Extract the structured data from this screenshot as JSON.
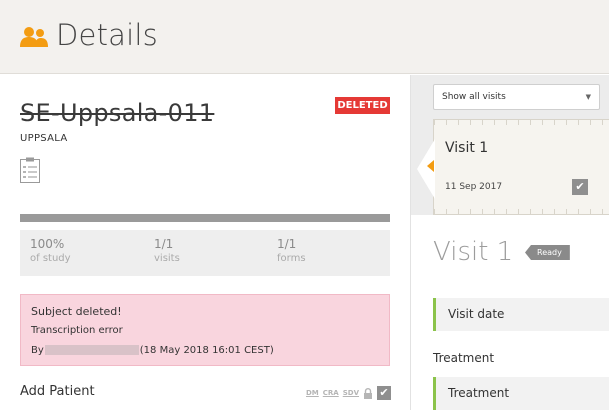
{
  "header": {
    "title": "Details",
    "icon": "users-icon",
    "accent_color": "#f39c12"
  },
  "subject": {
    "id": "SE-Uppsala-011",
    "site": "UPPSALA",
    "status_badge": "DELETED",
    "status_color": "#e53935",
    "progress_percent": 100,
    "stats": [
      {
        "value": "100%",
        "label": "of study"
      },
      {
        "value": "1/1",
        "label": "visits"
      },
      {
        "value": "1/1",
        "label": "forms"
      }
    ],
    "alert": {
      "title": "Subject deleted!",
      "reason": "Transcription error",
      "by_prefix": "By",
      "by_suffix": "(18 May 2018 16:01 CEST)"
    },
    "form_label": "Add Patient",
    "form_flags": [
      "DM",
      "CRA",
      "SDV"
    ]
  },
  "visits_panel": {
    "filter_value": "Show all visits",
    "visit_card": {
      "title": "Visit 1",
      "date": "11 Sep 2017"
    },
    "selected_visit": {
      "title": "Visit 1",
      "status": "Ready"
    },
    "form_rows": [
      {
        "label": "Visit date"
      },
      {
        "label": "Treatment"
      }
    ],
    "section_label": "Treatment",
    "row_accent_color": "#8bc34a"
  }
}
